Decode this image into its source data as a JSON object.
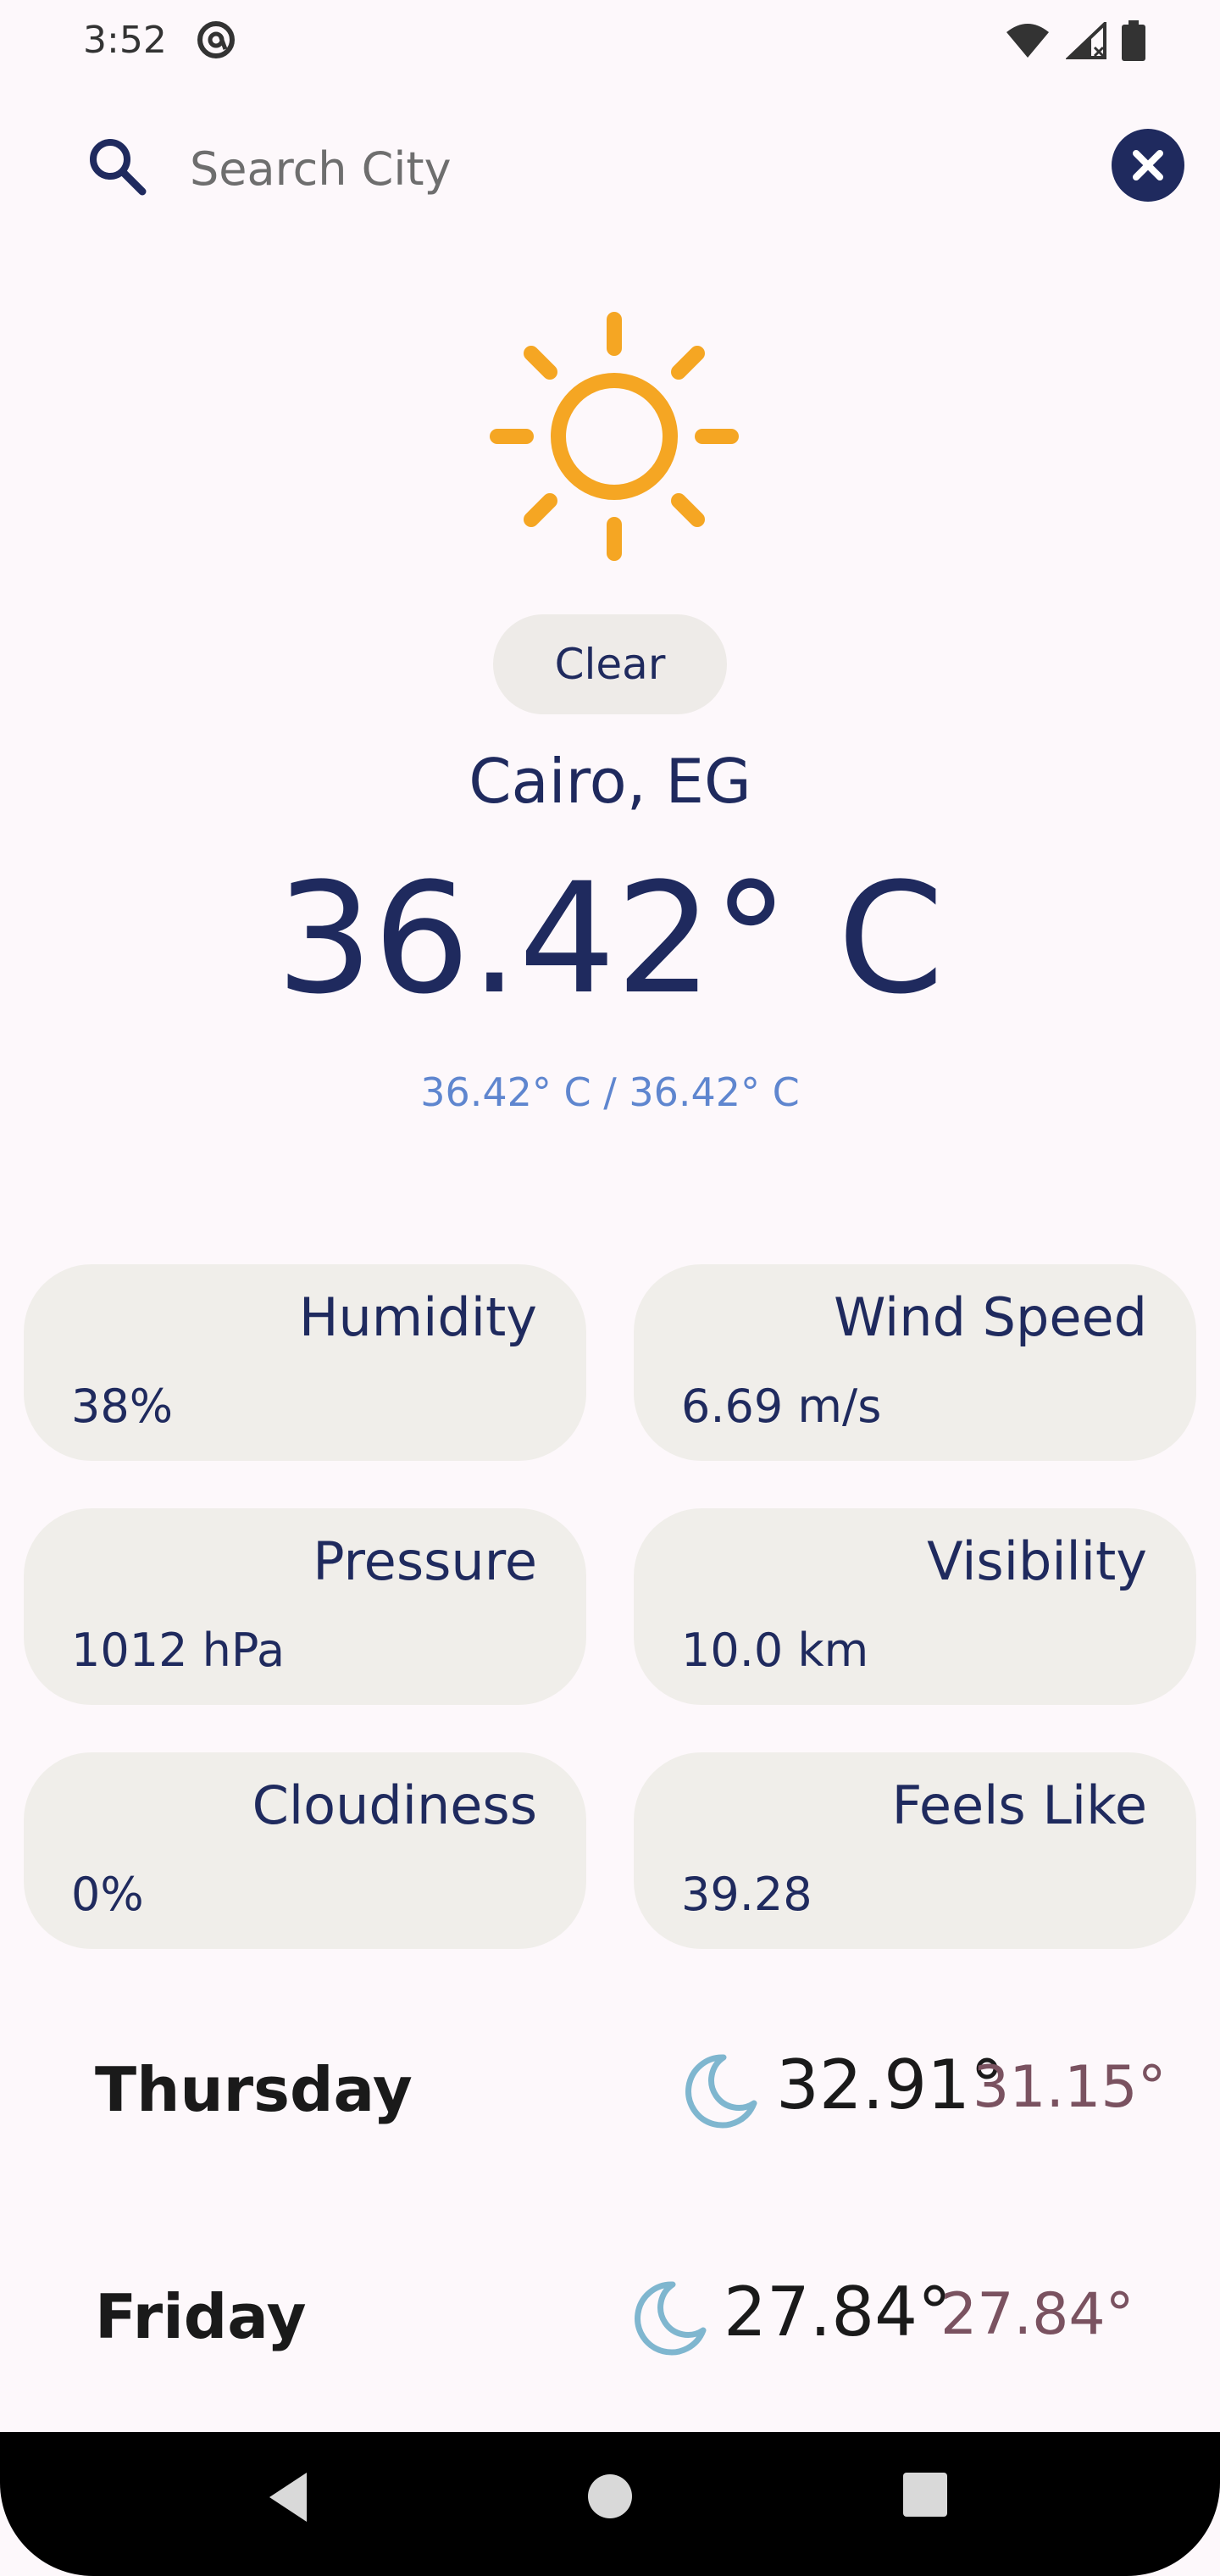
{
  "status_bar": {
    "time": "3:52",
    "icons": [
      "at-sign-icon",
      "wifi-icon",
      "cell-signal-icon",
      "battery-icon"
    ]
  },
  "search": {
    "placeholder": "Search City",
    "value": "",
    "icon": "search-icon",
    "clear_icon": "close-icon"
  },
  "weather": {
    "icon": "sun-icon",
    "condition": "Clear",
    "city": "Cairo, EG",
    "temperature": "36.42° C",
    "range": "36.42° C / 36.42° C"
  },
  "details": [
    {
      "label": "Humidity",
      "value": "38%"
    },
    {
      "label": "Wind Speed",
      "value": "6.69 m/s"
    },
    {
      "label": "Pressure",
      "value": "1012 hPa"
    },
    {
      "label": "Visibility",
      "value": "10.0 km"
    },
    {
      "label": "Cloudiness",
      "value": "0%"
    },
    {
      "label": "Feels Like",
      "value": "39.28"
    }
  ],
  "forecast": [
    {
      "day": "Thursday",
      "icon": "moon-icon",
      "high": "32.91°",
      "low": "31.15°"
    },
    {
      "day": "Friday",
      "icon": "moon-icon",
      "high": "27.84°",
      "low": "27.84°"
    }
  ],
  "colors": {
    "primary": "#1f2a5e",
    "sun": "#f5a623",
    "moon": "#7fb6cf",
    "card": "#f0eeea",
    "range_text": "#5f86cf",
    "low_temp": "#7a5260"
  },
  "nav": {
    "buttons": [
      "back-icon",
      "home-icon",
      "recents-icon"
    ]
  }
}
